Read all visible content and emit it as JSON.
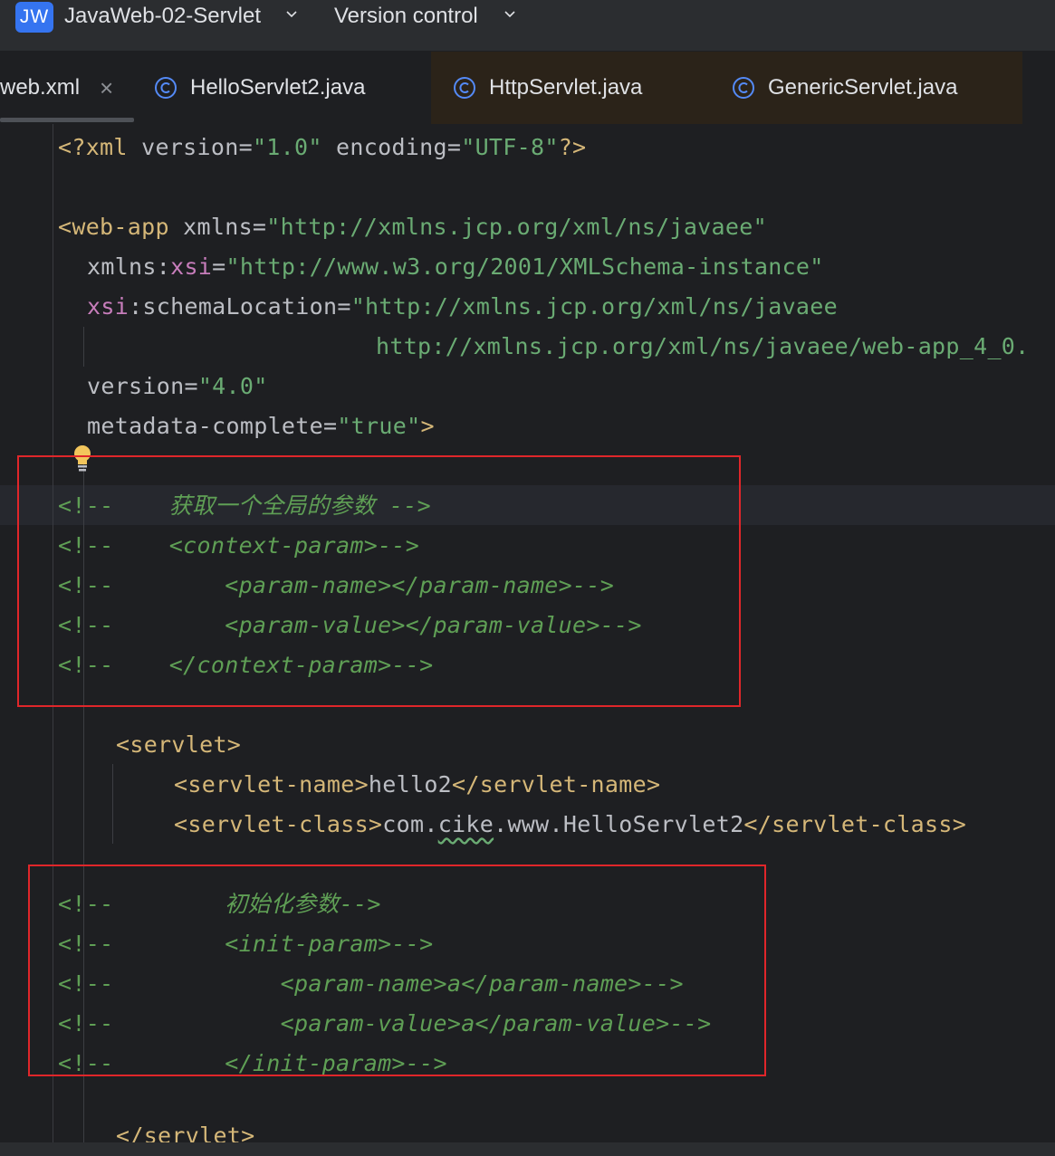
{
  "header": {
    "project_badge": "JW",
    "project_name": "JavaWeb-02-Servlet",
    "vcs_label": "Version control"
  },
  "tabs": [
    {
      "label": "web.xml",
      "active": true,
      "closable": true
    },
    {
      "label": "HelloServlet2.java",
      "icon": "java-class-icon"
    },
    {
      "label": "HttpServlet.java",
      "icon": "java-class-icon"
    },
    {
      "label": "GenericServlet.java",
      "icon": "java-class-icon"
    }
  ],
  "code": {
    "l1": {
      "a": "<?",
      "b": "xml",
      "c": " version=",
      "d": "\"1.0\"",
      "e": " encoding=",
      "f": "\"UTF-8\"",
      "g": "?>"
    },
    "l3": {
      "a": "<web-app",
      "b": " xmlns=",
      "c": "\"http://xmlns.jcp.org/xml/ns/javaee\""
    },
    "l4": {
      "a": "xmlns:",
      "b": "xsi",
      "c": "=",
      "d": "\"http://www.w3.org/2001/XMLSchema-instance\""
    },
    "l5": {
      "a": "xsi",
      "b": ":schemaLocation=",
      "c": "\"http://xmlns.jcp.org/xml/ns/javaee"
    },
    "l6": {
      "a": "http://xmlns.jcp.org/xml/ns/javaee/web-app_4_0."
    },
    "l7": {
      "a": "version=",
      "b": "\"4.0\""
    },
    "l8": {
      "a": "metadata-complete=",
      "b": "\"true\"",
      "c": ">"
    },
    "l10": {
      "a": "<!--",
      "b": "    获取一个全局的参数 -->"
    },
    "l11": {
      "a": "<!--",
      "b": "    <context-param>-->"
    },
    "l12": {
      "a": "<!--",
      "b": "        <param-name></param-name>-->"
    },
    "l13": {
      "a": "<!--",
      "b": "        <param-value></param-value>-->"
    },
    "l14": {
      "a": "<!--",
      "b": "    </context-param>-->"
    },
    "l16": {
      "a": "<servlet>"
    },
    "l17": {
      "a": "<servlet-name>",
      "b": "hello2",
      "c": "</servlet-name>"
    },
    "l18": {
      "a": "<servlet-class>",
      "b": "com.",
      "c": "cike",
      "d": ".www.HelloServlet2",
      "e": "</servlet-class>"
    },
    "l20": {
      "a": "<!--",
      "b": "        初始化参数-->"
    },
    "l21": {
      "a": "<!--",
      "b": "        <init-param>-->"
    },
    "l22": {
      "a": "<!--",
      "b": "            <param-name>a</param-name>-->"
    },
    "l23": {
      "a": "<!--",
      "b": "            <param-value>a</param-value>-->"
    },
    "l24": {
      "a": "<!--",
      "b": "        </init-param>-->"
    },
    "l26": {
      "a": "</servlet>"
    }
  },
  "colors": {
    "tag": "#d5b778",
    "string": "#6aab73",
    "namespace": "#c77dbb",
    "comment": "#5f9f55",
    "highlight_box": "#e0262a"
  }
}
